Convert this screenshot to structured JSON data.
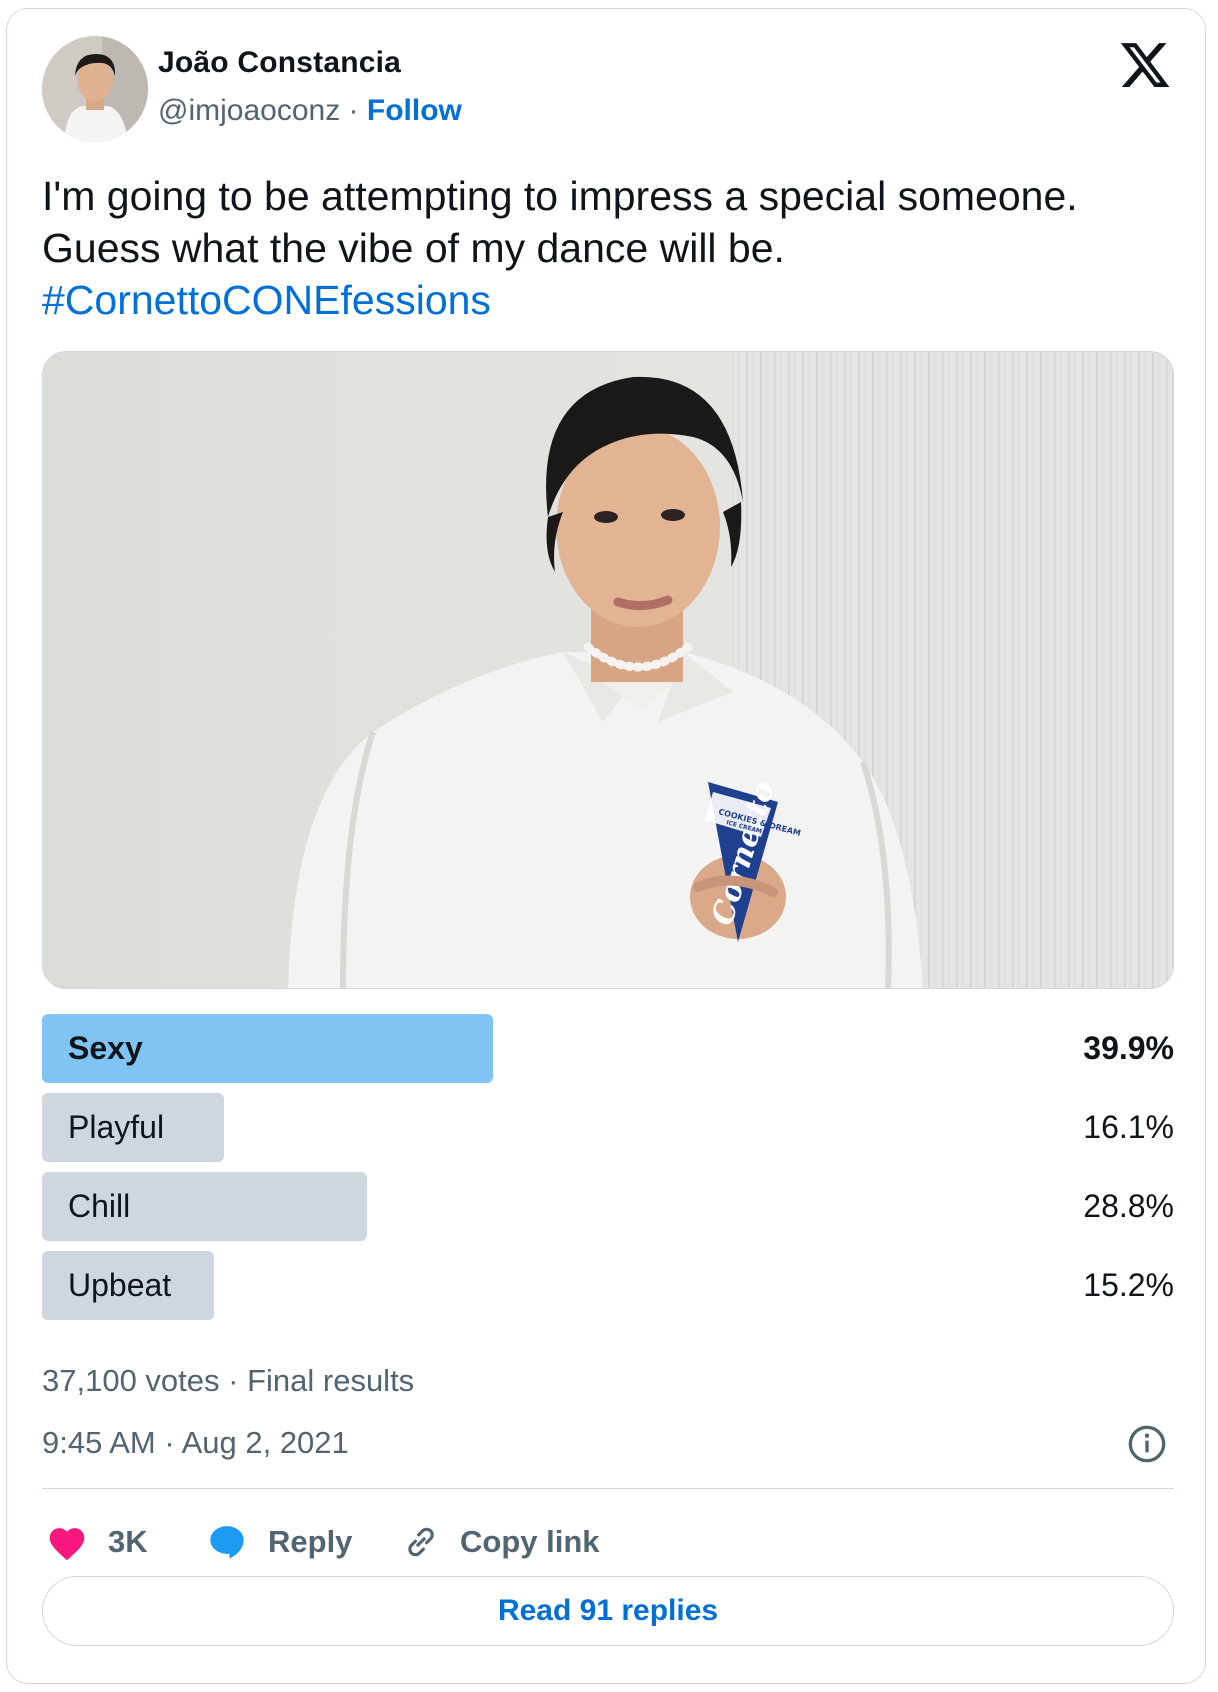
{
  "author": {
    "name": "João Constancia",
    "handle": "@imjoaoconz",
    "separator": "·",
    "follow_label": "Follow"
  },
  "tweet": {
    "line1": "I'm going to be attempting to impress a special someone.",
    "line2": "Guess what the vibe of my dance will be.",
    "hashtag": "#CornettoCONEfessions"
  },
  "media": {
    "product_text": "Cornetto",
    "product_flavor": "COOKIES & DREAM",
    "product_sub": "ICE CREAM"
  },
  "poll": {
    "options": [
      {
        "label": "Sexy",
        "percent": "39.9%",
        "value": 39.9,
        "winner": true
      },
      {
        "label": "Playful",
        "percent": "16.1%",
        "value": 16.1,
        "winner": false
      },
      {
        "label": "Chill",
        "percent": "28.8%",
        "value": 28.8,
        "winner": false
      },
      {
        "label": "Upbeat",
        "percent": "15.2%",
        "value": 15.2,
        "winner": false
      }
    ],
    "summary": "37,100 votes · Final results"
  },
  "timestamp": "9:45 AM · Aug 2, 2021",
  "actions": {
    "likes": "3K",
    "reply": "Reply",
    "copy_link": "Copy link"
  },
  "read_replies": "Read 91 replies",
  "colors": {
    "accent": "#006fd6",
    "winner_bar": "#80c4f6",
    "loser_bar": "#cfd9de",
    "heart": "#f91880",
    "reply_bubble": "#1d9bf0",
    "muted": "#536471"
  },
  "icons": [
    "x-logo-icon",
    "heart-icon",
    "reply-bubble-icon",
    "link-icon",
    "info-icon"
  ]
}
